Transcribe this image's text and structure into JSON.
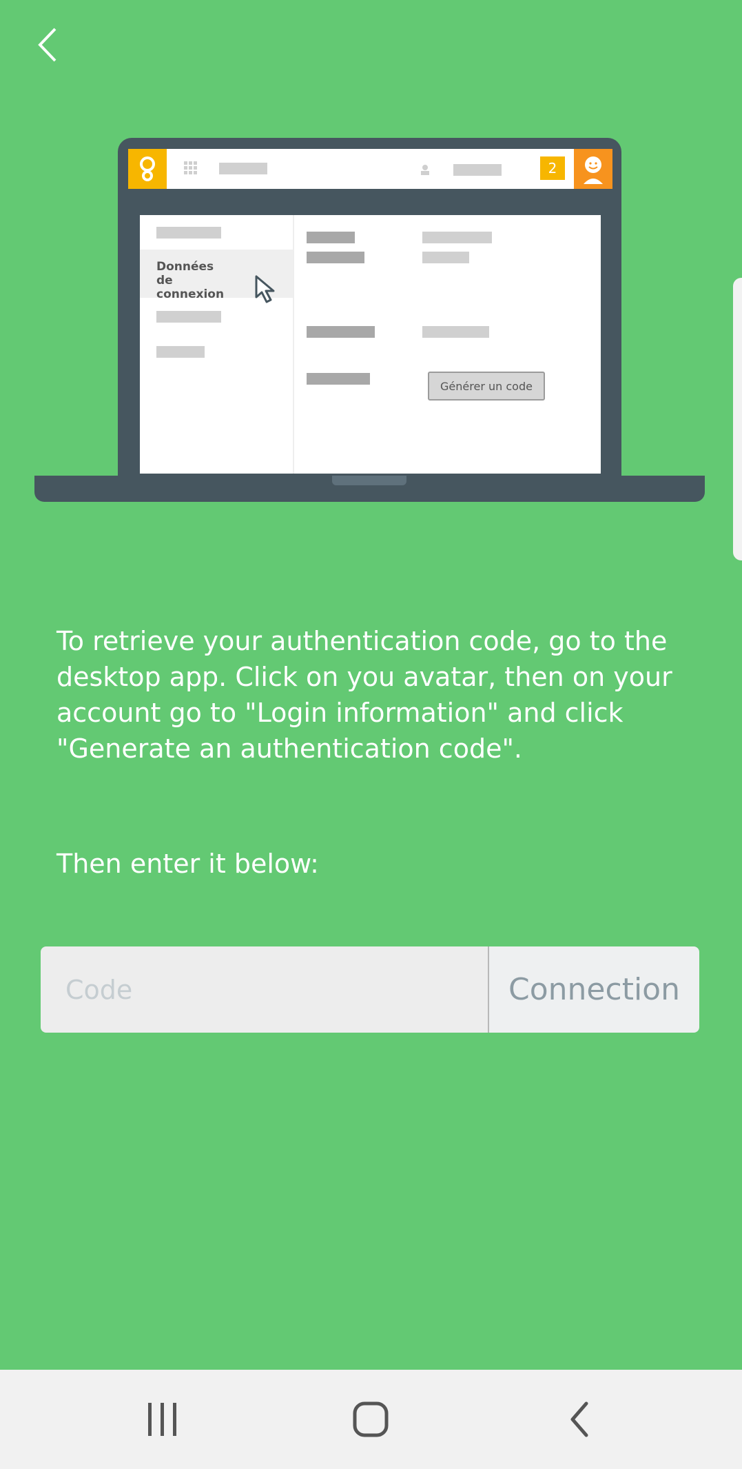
{
  "nav": {
    "back_icon": "chevron-left-icon"
  },
  "illustration": {
    "sidebar_active_label": "Données de connexion",
    "generate_button_label": "Générer un code",
    "notification_count": "2",
    "colors": {
      "lid": "#46565f",
      "accent_yellow": "#f7b600",
      "accent_orange": "#f7931e"
    }
  },
  "instructions": {
    "paragraph": "To retrieve your authentication code, go to the desktop app. Click on you avatar, then on your account go to \"Login information\" and click \"Generate an authentication code\".",
    "then_enter": "Then enter it below:"
  },
  "code_form": {
    "placeholder": "Code",
    "value": "",
    "connect_label": "Connection"
  },
  "system_nav": {
    "recents_icon": "recents-icon",
    "home_icon": "home-icon",
    "back_icon": "back-icon"
  },
  "theme": {
    "background": "#63c973",
    "navbar_bg": "#f1f1f1"
  }
}
